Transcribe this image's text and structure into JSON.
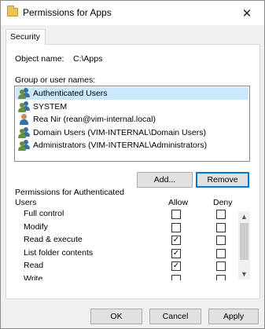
{
  "window": {
    "title": "Permissions for Apps",
    "close": "✕"
  },
  "tab": {
    "label": "Security"
  },
  "object": {
    "label": "Object name:",
    "value": "C:\\Apps"
  },
  "users": {
    "label": "Group or user names:",
    "items": [
      {
        "name": "Authenticated Users",
        "icon": "group-icon",
        "selected": true
      },
      {
        "name": "SYSTEM",
        "icon": "group-icon",
        "selected": false
      },
      {
        "name": "Rea Nir (rean@vim-internal.local)",
        "icon": "user-icon",
        "selected": false
      },
      {
        "name": "Domain Users (VIM-INTERNAL\\Domain Users)",
        "icon": "group-icon",
        "selected": false
      },
      {
        "name": "Administrators (VIM-INTERNAL\\Administrators)",
        "icon": "group-icon",
        "selected": false
      }
    ]
  },
  "buttons": {
    "add": "Add...",
    "remove": "Remove"
  },
  "permissions": {
    "label_line1": "Permissions for Authenticated",
    "label_line2": "Users",
    "allow_header": "Allow",
    "deny_header": "Deny",
    "rows": [
      {
        "name": "Full control",
        "allow": false,
        "deny": false
      },
      {
        "name": "Modify",
        "allow": false,
        "deny": false
      },
      {
        "name": "Read & execute",
        "allow": true,
        "deny": false
      },
      {
        "name": "List folder contents",
        "allow": true,
        "deny": false
      },
      {
        "name": "Read",
        "allow": true,
        "deny": false
      },
      {
        "name": "Write",
        "allow": false,
        "deny": false
      }
    ]
  },
  "footer": {
    "ok": "OK",
    "cancel": "Cancel",
    "apply": "Apply"
  },
  "colors": {
    "selection": "#cce8ff",
    "accent": "#0078d7",
    "group_icon": "#6b8e3a",
    "user_icon": "#3a6ea5"
  }
}
